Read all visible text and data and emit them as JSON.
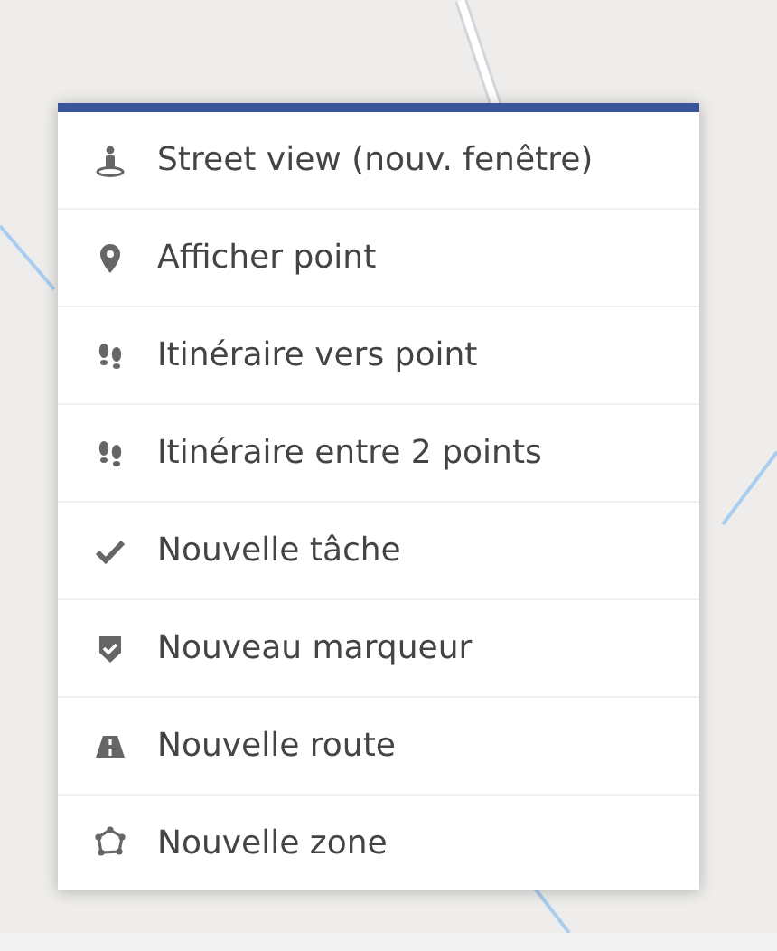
{
  "context_menu": {
    "items": [
      {
        "kind": "street-view",
        "label": "Street view (nouv. fenêtre)"
      },
      {
        "kind": "pin",
        "label": "Afficher point"
      },
      {
        "kind": "footsteps",
        "label": "Itinéraire vers point"
      },
      {
        "kind": "footsteps",
        "label": "Itinéraire entre 2 points"
      },
      {
        "kind": "check",
        "label": "Nouvelle tâche"
      },
      {
        "kind": "shield-check",
        "label": "Nouveau marqueur"
      },
      {
        "kind": "road",
        "label": "Nouvelle route"
      },
      {
        "kind": "polygon",
        "label": "Nouvelle zone"
      }
    ]
  }
}
